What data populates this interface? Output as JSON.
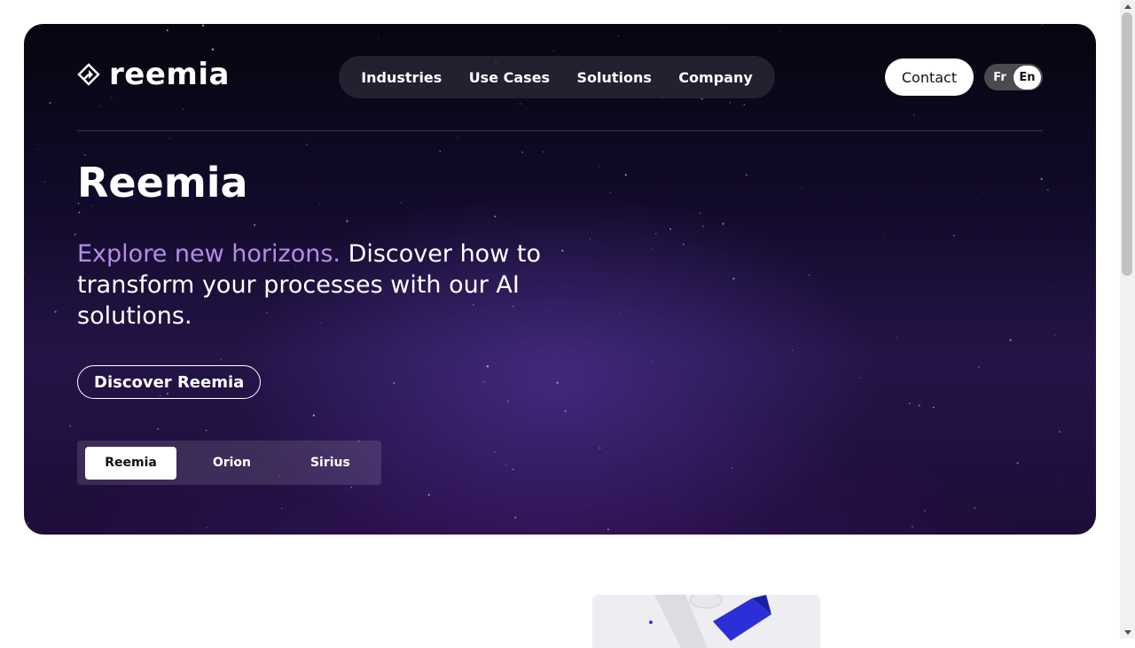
{
  "brand": {
    "name": "reemia",
    "logo_icon": "reemia-logo-icon"
  },
  "nav": {
    "items": [
      {
        "label": "Industries"
      },
      {
        "label": "Use Cases"
      },
      {
        "label": "Solutions"
      },
      {
        "label": "Company"
      }
    ]
  },
  "header": {
    "contact_label": "Contact",
    "languages": [
      {
        "code": "Fr",
        "active": false
      },
      {
        "code": "En",
        "active": true
      }
    ]
  },
  "hero": {
    "title": "Reemia",
    "tagline_accent": "Explore new horizons.",
    "tagline_rest": " Discover how to transform your processes with our AI solutions.",
    "cta_label": "Discover Reemia",
    "tabs": [
      {
        "label": "Reemia",
        "active": true
      },
      {
        "label": "Orion",
        "active": false
      },
      {
        "label": "Sirius",
        "active": false
      }
    ]
  },
  "colors": {
    "accent": "#b48de8",
    "hero_dark": "#07050f",
    "hero_purple": "#241447"
  }
}
